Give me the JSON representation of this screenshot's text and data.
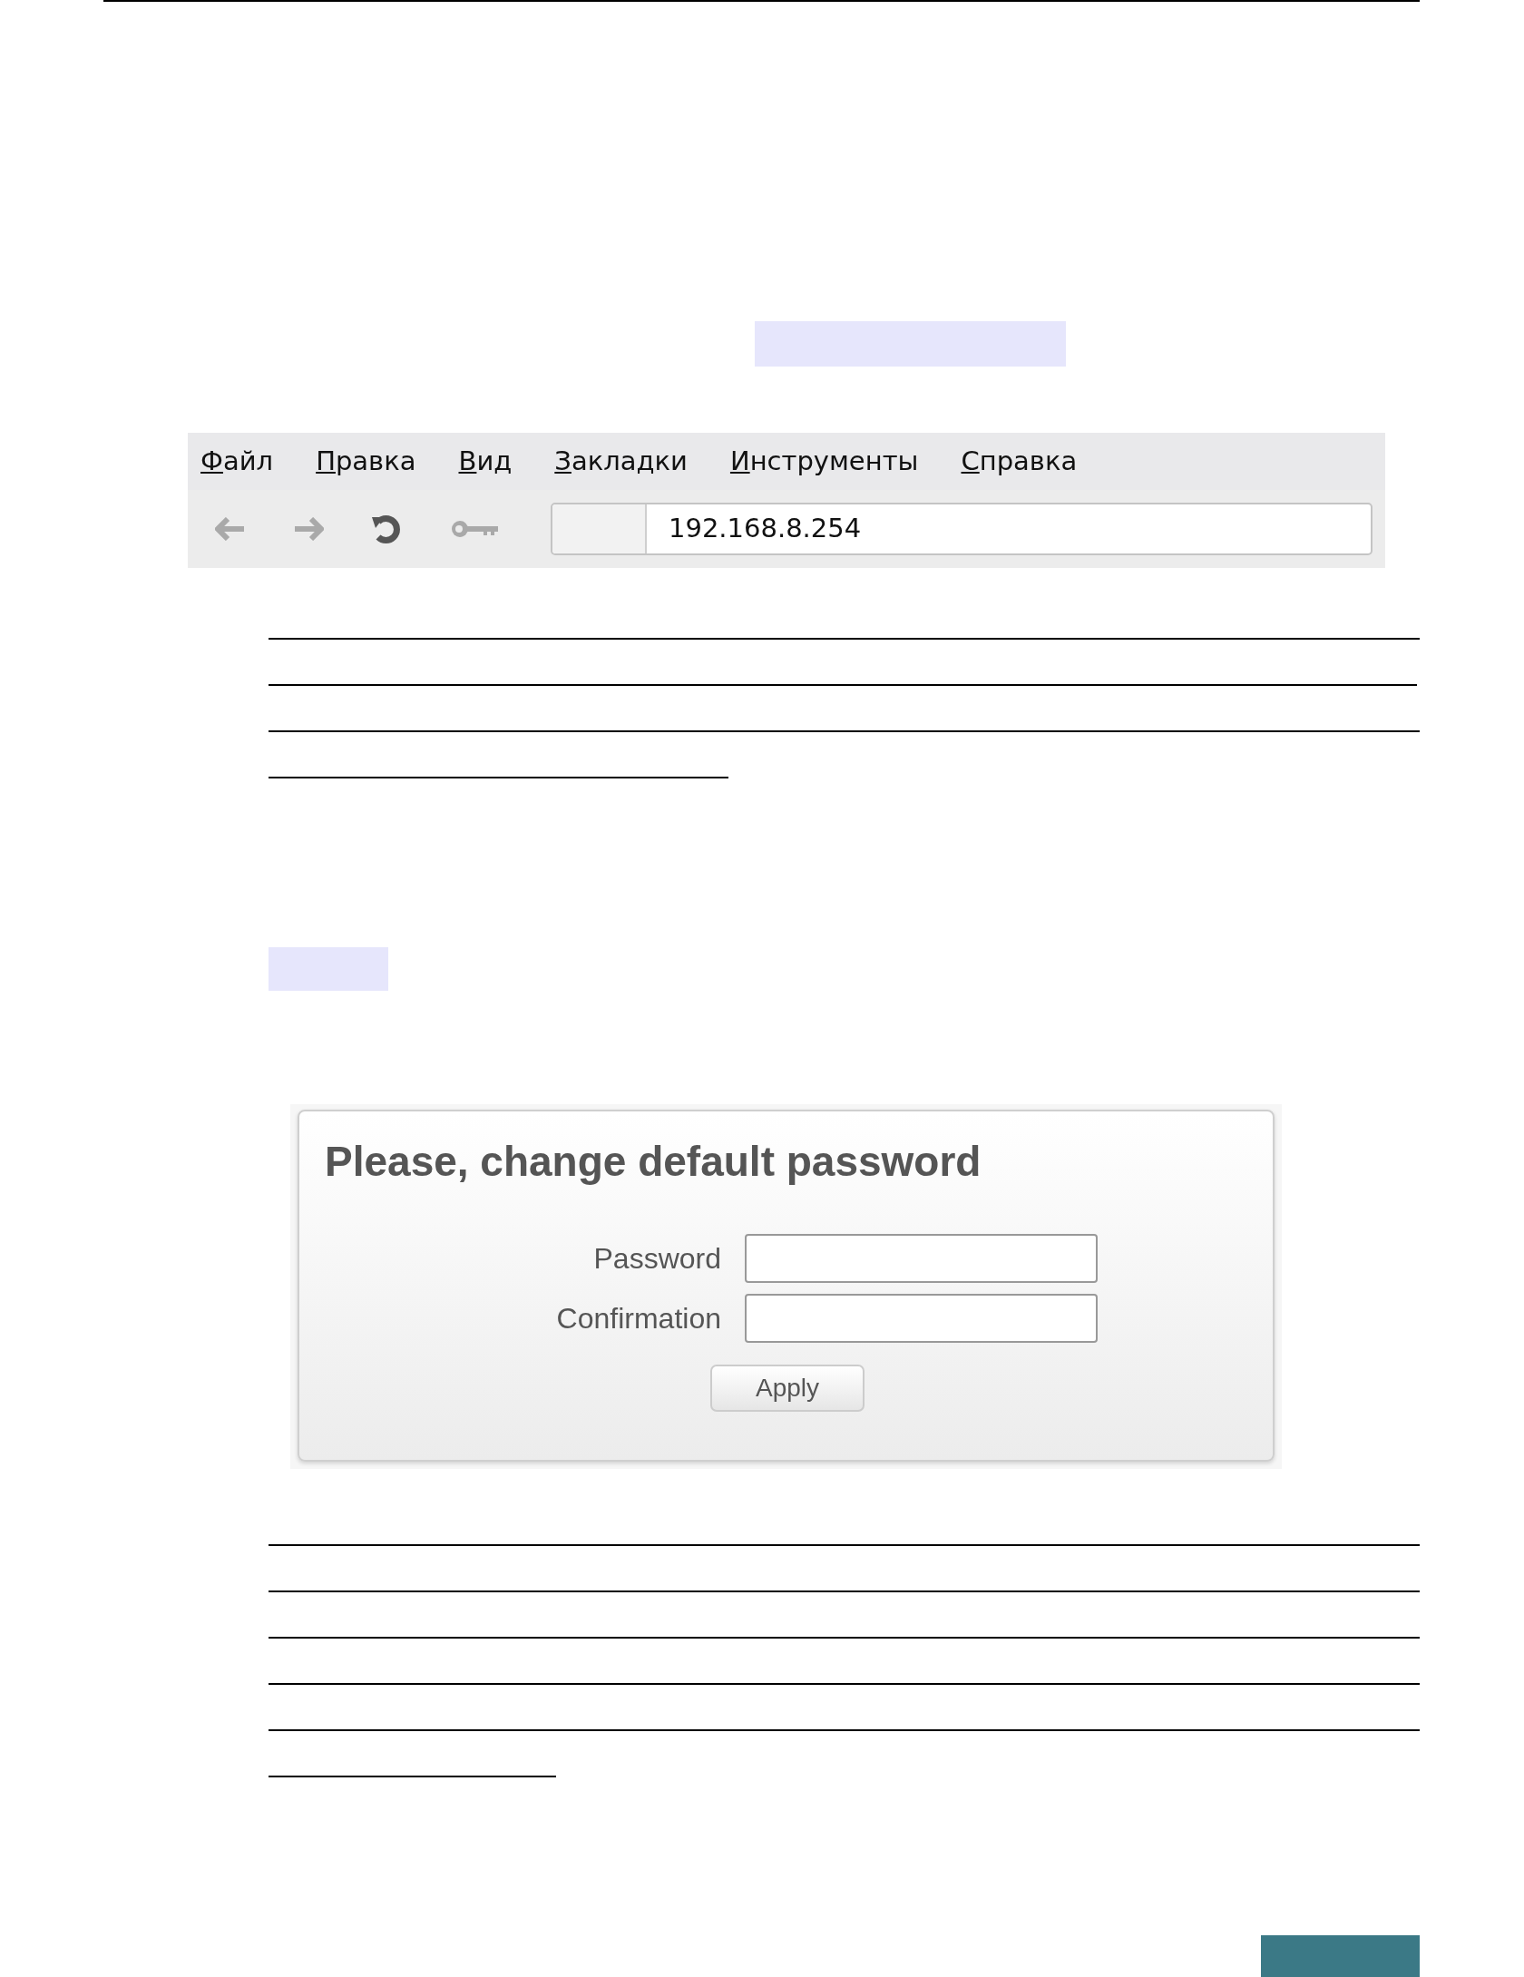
{
  "browser": {
    "menu": [
      {
        "label": "Файл",
        "mnemonic": true
      },
      {
        "label": "Правка",
        "mnemonic": true
      },
      {
        "label": "Вид",
        "mnemonic": true
      },
      {
        "label": "Закладки",
        "mnemonic": true
      },
      {
        "label": "Инструменты",
        "mnemonic": true
      },
      {
        "label": "Справка",
        "mnemonic": true
      }
    ],
    "address": {
      "value": "192.168.8.254"
    }
  },
  "dialog": {
    "title": "Please, change default password",
    "fields": [
      {
        "label": "Password"
      },
      {
        "label": "Confirmation"
      }
    ],
    "button": "Apply"
  }
}
